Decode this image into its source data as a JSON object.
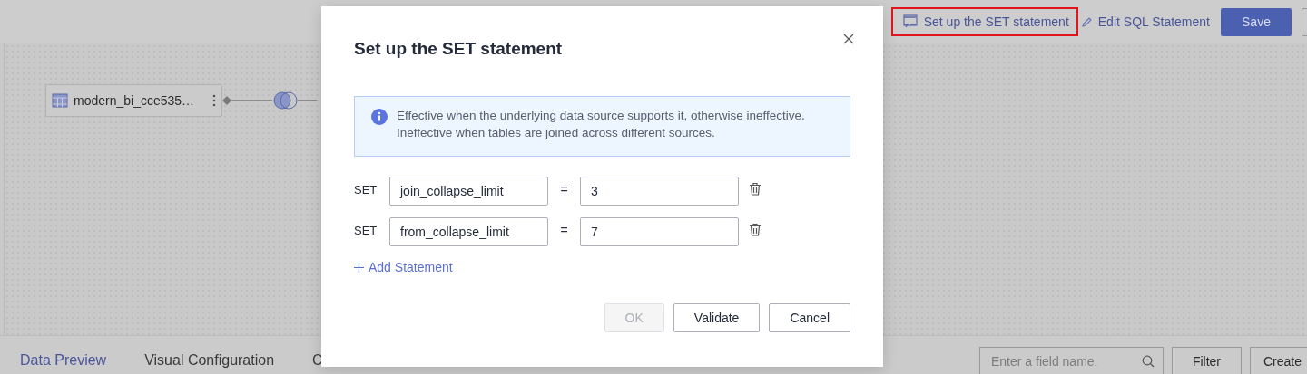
{
  "toolbar": {
    "actions": [
      {
        "kind": "set",
        "label": "Set up the SET statement",
        "highlighted": true
      },
      {
        "kind": "edit",
        "label": "Edit SQL Statement",
        "highlighted": false
      }
    ],
    "save": "Save"
  },
  "canvas": {
    "node": {
      "label": "modern_bi_cce535…"
    }
  },
  "bottom_tabs": [
    {
      "label": "Data Preview",
      "selected": true
    },
    {
      "label": "Visual Configuration",
      "selected": false
    },
    {
      "label": "C",
      "selected": false
    }
  ],
  "field_search": {
    "placeholder": "Enter a field name."
  },
  "bottom_buttons": [
    "Filter",
    "Create"
  ],
  "dialog": {
    "title": "Set up the SET statement",
    "info": [
      "Effective when the underlying data source supports it, otherwise ineffective.",
      "Ineffective when tables are joined across different sources."
    ],
    "statements": [
      {
        "keyword": "SET",
        "name": "join_collapse_limit",
        "operator": "=",
        "value": "3"
      },
      {
        "keyword": "SET",
        "name": "from_collapse_limit",
        "operator": "=",
        "value": "7"
      }
    ],
    "add_label": "Add Statement",
    "buttons": [
      {
        "label": "OK",
        "disabled": true
      },
      {
        "label": "Validate",
        "disabled": false
      },
      {
        "label": "Cancel",
        "disabled": false
      }
    ]
  }
}
